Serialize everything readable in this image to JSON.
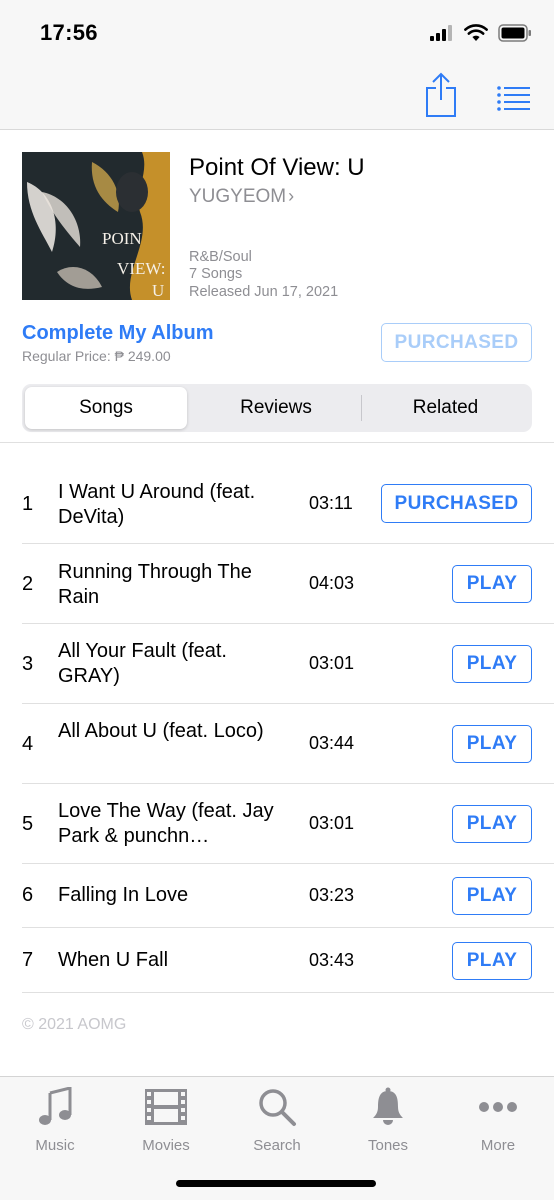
{
  "status_bar": {
    "time": "17:56"
  },
  "colors": {
    "accent": "#2f7cf6",
    "secondary_text": "#8e8e93",
    "disabled_accent": "#a9cdf9"
  },
  "nav": {
    "share_icon": "share-icon",
    "list_icon": "list-icon"
  },
  "album": {
    "artwork_text": "POINT OF VIEW: U",
    "title": "Point Of View: U",
    "artist": "YUGYEOM",
    "genre": "R&B/Soul",
    "songs_count": "7 Songs",
    "released": "Released Jun 17, 2021"
  },
  "purchase": {
    "complete_label": "Complete My Album",
    "regular_price": "Regular Price: ₱ 249.00",
    "purchased_label": "PURCHASED"
  },
  "tabs": [
    "Songs",
    "Reviews",
    "Related"
  ],
  "tracks": [
    {
      "num": "1",
      "title": "I Want U Around (feat. DeVita)",
      "duration": "03:11",
      "action": "PURCHASED"
    },
    {
      "num": "2",
      "title": "Running Through The Rain",
      "duration": "04:03",
      "action": "PLAY"
    },
    {
      "num": "3",
      "title": "All Your Fault (feat. GRAY)",
      "duration": "03:01",
      "action": "PLAY"
    },
    {
      "num": "4",
      "title": "All About U (feat. Loco)",
      "duration": "03:44",
      "action": "PLAY"
    },
    {
      "num": "5",
      "title": "Love The Way (feat. Jay Park & punchn…",
      "duration": "03:01",
      "action": "PLAY"
    },
    {
      "num": "6",
      "title": "Falling In Love",
      "duration": "03:23",
      "action": "PLAY"
    },
    {
      "num": "7",
      "title": "When U Fall",
      "duration": "03:43",
      "action": "PLAY"
    }
  ],
  "copyright": "© 2021 AOMG",
  "tab_bar": [
    {
      "label": "Music",
      "icon": "music-note-icon"
    },
    {
      "label": "Movies",
      "icon": "film-icon"
    },
    {
      "label": "Search",
      "icon": "search-icon"
    },
    {
      "label": "Tones",
      "icon": "bell-icon"
    },
    {
      "label": "More",
      "icon": "more-icon"
    }
  ]
}
